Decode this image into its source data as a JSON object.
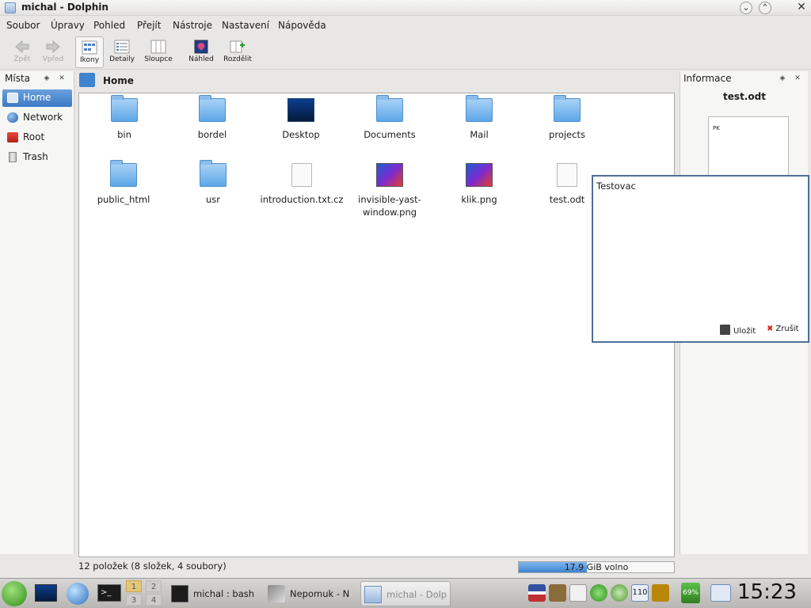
{
  "window": {
    "title": "michal - Dolphin"
  },
  "menubar": [
    "Soubor",
    "Úpravy",
    "Pohled",
    "Přejít",
    "Nástroje",
    "Nastavení",
    "Nápověda"
  ],
  "toolbar": {
    "back": "Zpět",
    "forward": "Vpřed",
    "icons": "Ikony",
    "details": "Detaily",
    "columns": "Sloupce",
    "preview": "Náhled",
    "split": "Rozdělit"
  },
  "places": {
    "title": "Místa",
    "items": [
      "Home",
      "Network",
      "Root",
      "Trash"
    ]
  },
  "breadcrumb": {
    "label": "Home"
  },
  "files": [
    {
      "name": "bin",
      "kind": "folder"
    },
    {
      "name": "bordel",
      "kind": "folder"
    },
    {
      "name": "Desktop",
      "kind": "desktop"
    },
    {
      "name": "Documents",
      "kind": "folder"
    },
    {
      "name": "Mail",
      "kind": "folder"
    },
    {
      "name": "projects",
      "kind": "folder"
    },
    {
      "name": "public_html",
      "kind": "folder"
    },
    {
      "name": "usr",
      "kind": "folder"
    },
    {
      "name": "introduction.txt.cz",
      "kind": "text"
    },
    {
      "name": "invisible-yast-window.png",
      "kind": "image"
    },
    {
      "name": "klik.png",
      "kind": "image"
    },
    {
      "name": "test.odt",
      "kind": "document"
    }
  ],
  "status": {
    "count_text": "12 položek (8 složek, 4 soubory)",
    "free_text": "17.9 GiB volno",
    "free_fill_fraction": 0.44
  },
  "info_panel": {
    "title": "Informace",
    "file": "test.odt",
    "preview_text": "PK"
  },
  "popup": {
    "text": "Testovac",
    "save": "Uložit",
    "cancel": "Zrušit"
  },
  "taskbar": {
    "tasks": [
      "michal : bash",
      "Nepomuk - N",
      "michal - Dolp"
    ],
    "desktops": [
      "1",
      "2",
      "3",
      "4"
    ],
    "tray": {
      "battery": "69%",
      "updates": "110"
    },
    "clock": "15:23"
  },
  "colors": {
    "selection": "#3c79c4",
    "folder": "#5ea7e8",
    "popup_border": "#4d6f99"
  }
}
